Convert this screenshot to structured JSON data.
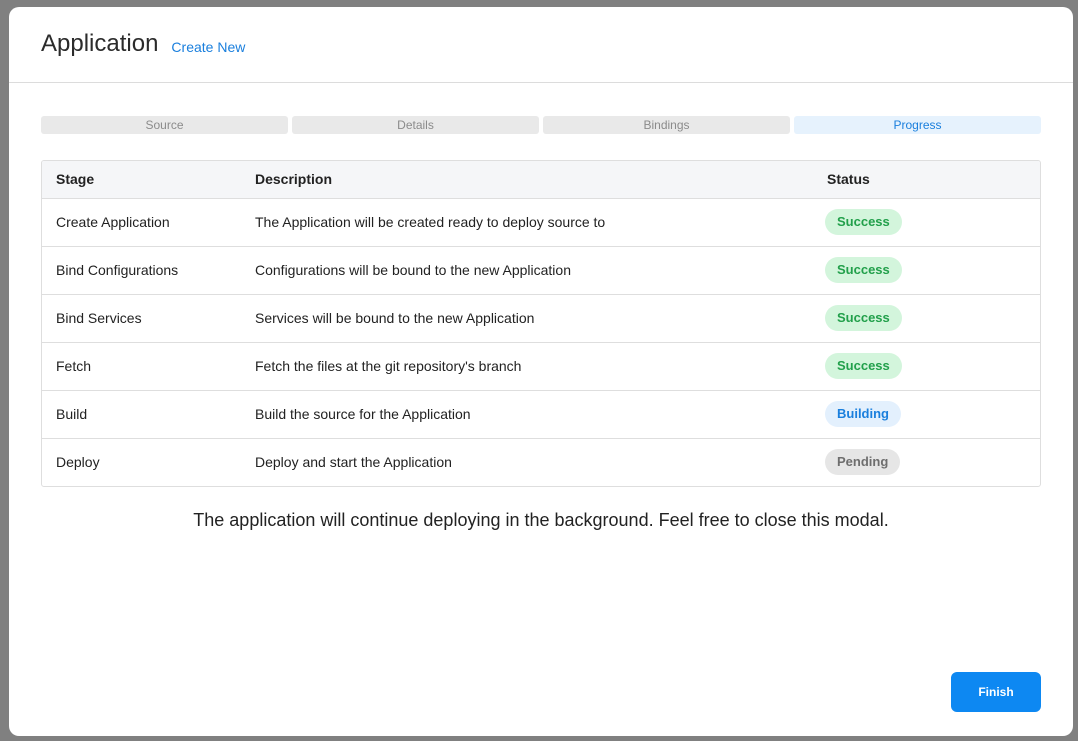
{
  "modal": {
    "title": "Application",
    "create_new_label": "Create New"
  },
  "stepper": {
    "steps": [
      {
        "label": "Source",
        "active": false
      },
      {
        "label": "Details",
        "active": false
      },
      {
        "label": "Bindings",
        "active": false
      },
      {
        "label": "Progress",
        "active": true
      }
    ]
  },
  "table": {
    "headers": {
      "stage": "Stage",
      "description": "Description",
      "status": "Status"
    },
    "rows": [
      {
        "stage": "Create Application",
        "description": "The Application will be created ready to deploy source to",
        "status": "Success"
      },
      {
        "stage": "Bind Configurations",
        "description": "Configurations will be bound to the new Application",
        "status": "Success"
      },
      {
        "stage": "Bind Services",
        "description": "Services will be bound to the new Application",
        "status": "Success"
      },
      {
        "stage": "Fetch",
        "description": "Fetch the files at the git repository's branch",
        "status": "Success"
      },
      {
        "stage": "Build",
        "description": "Build the source for the Application",
        "status": "Building"
      },
      {
        "stage": "Deploy",
        "description": "Deploy and start the Application",
        "status": "Pending"
      }
    ]
  },
  "notice": "The application will continue deploying in the background. Feel free to close this modal.",
  "footer": {
    "finish_label": "Finish"
  },
  "colors": {
    "accent": "#0d88f2",
    "success_bg": "#d3f5dc",
    "success_text": "#22a04b",
    "building_bg": "#e3f0fd",
    "building_text": "#1a7fdd",
    "pending_bg": "#e6e6e6",
    "pending_text": "#6e6e6e"
  }
}
